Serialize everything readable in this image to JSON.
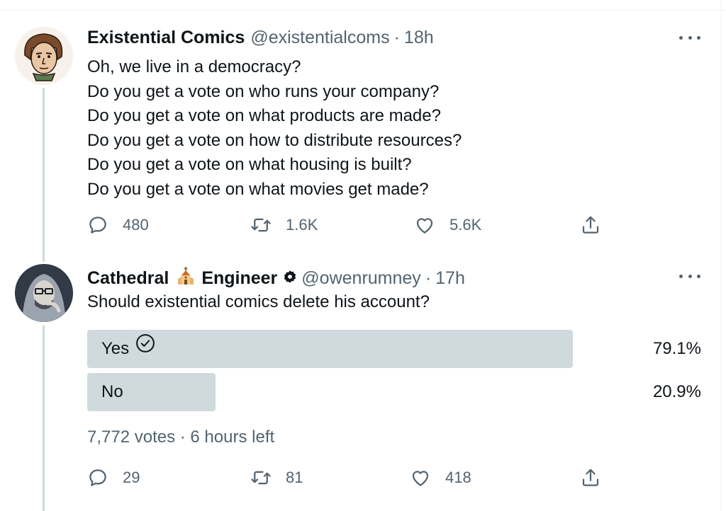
{
  "tweets": [
    {
      "name": "Existential Comics",
      "handle": "@existentialcoms",
      "separator": "·",
      "time": "18h",
      "lines": [
        "Oh, we live in a democracy?",
        "Do you get a vote on who runs your company?",
        "Do you get a vote on what products are made?",
        "Do you get a vote on how to distribute resources?",
        "Do you get a vote on what housing is built?",
        "Do you get a vote on what movies get made?"
      ],
      "replies": "480",
      "retweets": "1.6K",
      "likes": "5.6K"
    },
    {
      "name_part1": "Cathedral",
      "name_part2": "Engineer",
      "handle": "@owenrumney",
      "separator": "·",
      "time": "17h",
      "text": "Should existential comics delete his account?",
      "poll": {
        "options": [
          {
            "label": "Yes",
            "percent_label": "79.1%",
            "percent": 79.1,
            "selected": true
          },
          {
            "label": "No",
            "percent_label": "20.9%",
            "percent": 20.9,
            "selected": false
          }
        ],
        "votes_text": "7,772 votes · 6 hours left"
      },
      "replies": "29",
      "retweets": "81",
      "likes": "418"
    }
  ],
  "icons": {
    "reply": "reply-icon",
    "retweet": "retweet-icon",
    "like": "heart-icon",
    "share": "share-icon",
    "more": "more-icon",
    "verified": "verified-badge-icon",
    "church": "church-emoji-icon",
    "check": "check-circle-icon"
  },
  "colors": {
    "text": "#0f1419",
    "secondary": "#536471",
    "poll_bar": "#cfd9de"
  }
}
